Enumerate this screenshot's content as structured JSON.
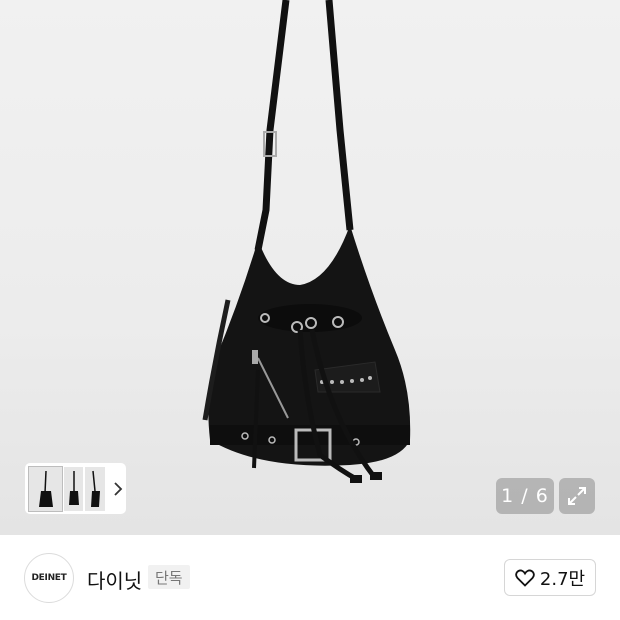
{
  "gallery": {
    "counter": "1 / 6",
    "thumbnails": [
      "thumbnail-1",
      "thumbnail-2",
      "thumbnail-3"
    ],
    "next_icon": "chevron-right-icon",
    "expand_icon": "expand-icon"
  },
  "brand": {
    "logo_text": "DEINET",
    "name": "다이닛",
    "badge": "단독"
  },
  "like": {
    "icon": "heart-icon",
    "count": "2.7만"
  }
}
